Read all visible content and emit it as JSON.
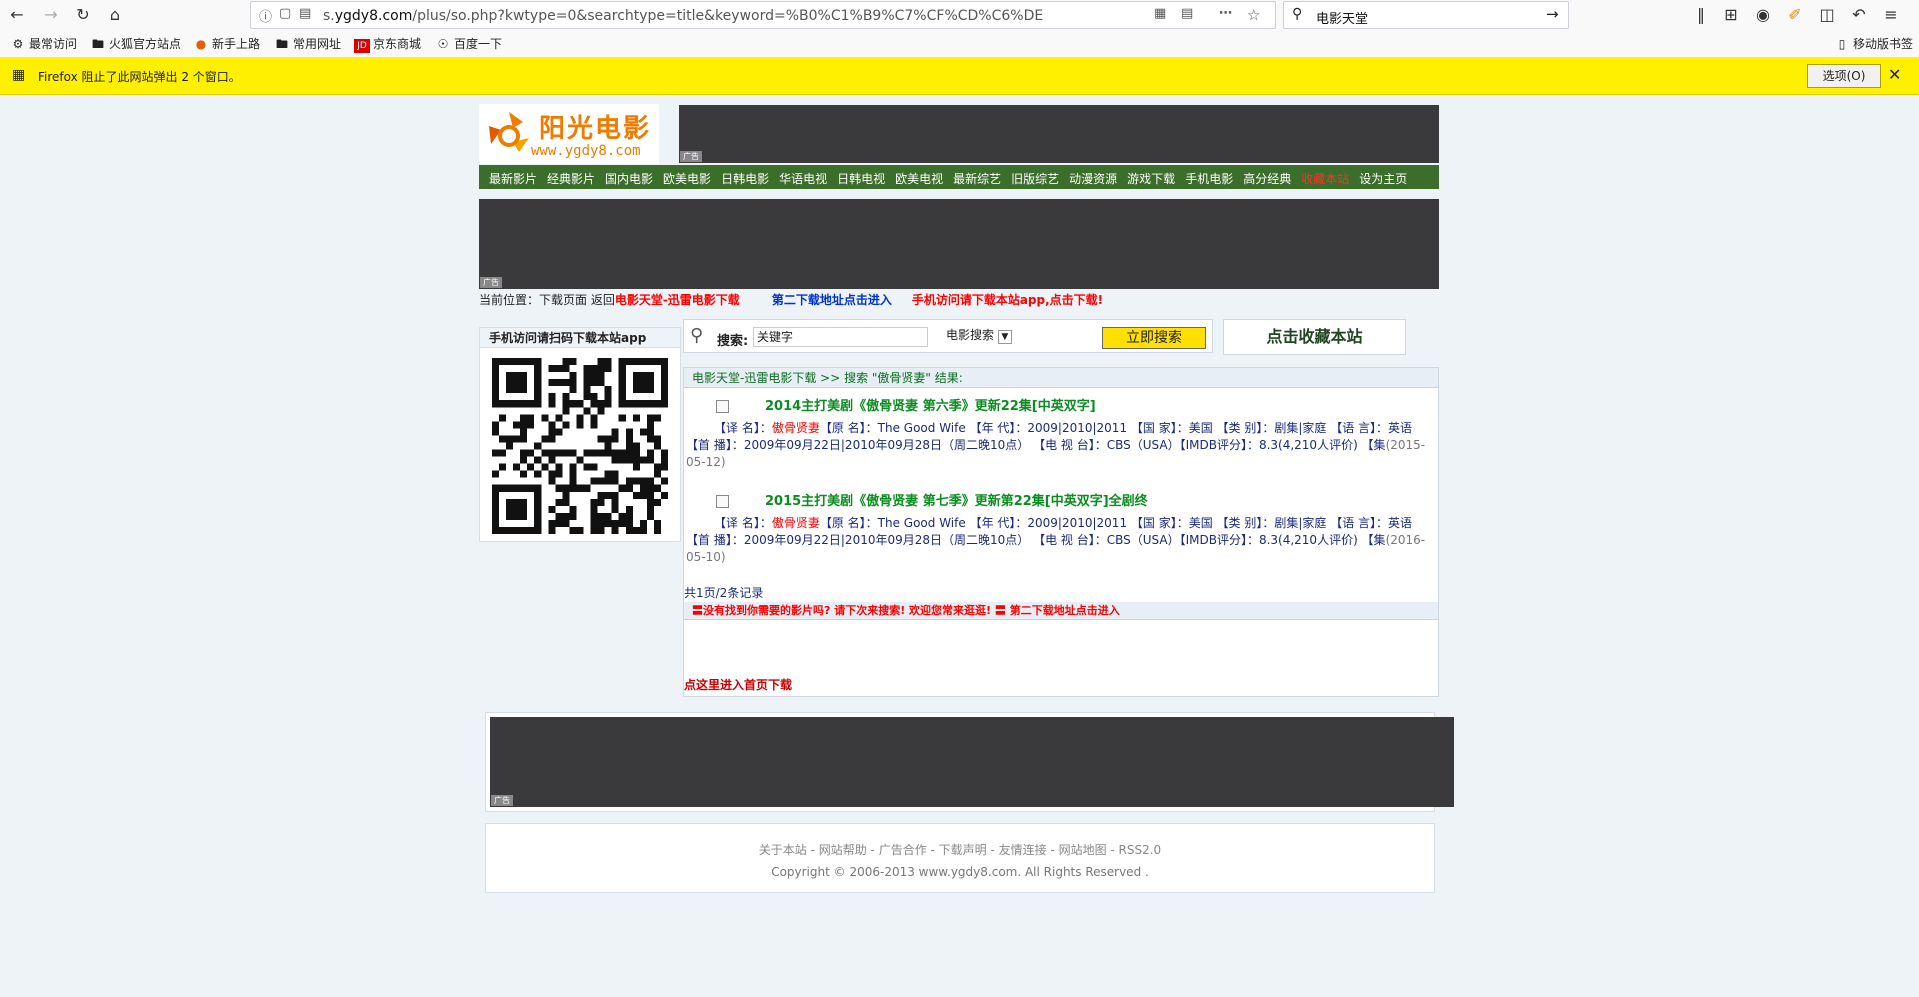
{
  "browser": {
    "url_prefix": "s.",
    "url_domain": "ygdy8.com",
    "url_rest": "/plus/so.php?kwtype=0&searchtype=title&keyword=%B0%C1%B9%C7%CF%CD%C6%DE",
    "search_value": "电影天堂",
    "bookmarks": [
      "最常访问",
      "火狐官方站点",
      "新手上路",
      "常用网址",
      "京东商城",
      "百度一下"
    ],
    "mobile_bookmarks": "移动版书签",
    "notification": "Firefox 阻止了此网站弹出 2 个窗口。",
    "notification_options": "选项(O)"
  },
  "site": {
    "logo_text": "阳光电影",
    "logo_url": "www.ygdy8.com",
    "ad_label": "广告",
    "nav": [
      "最新影片",
      "经典影片",
      "国内电影",
      "欧美电影",
      "日韩电影",
      "华语电视",
      "日韩电视",
      "欧美电视",
      "最新综艺",
      "旧版综艺",
      "动漫资源",
      "游戏下载",
      "手机电影",
      "高分经典",
      "收藏本站",
      "设为主页"
    ],
    "nav_red_index": 14,
    "crumb": {
      "prefix": "当前位置：下载页面 返回",
      "home": "电影天堂-迅雷电影下载",
      "second": "第二下载地址点击进入",
      "app": "手机访问请下载本站app,点击下载!"
    },
    "qr_title": "手机访问请扫码下载本站app",
    "search": {
      "label": "搜索:",
      "placeholder": "关键字",
      "select": "电影搜索",
      "button": "立即搜索"
    },
    "fav_button": "点击收藏本站",
    "results_head": "电影天堂-迅雷电影下载 >> 搜索 \"傲骨贤妻\" 结果:",
    "results": [
      {
        "title": "2014主打美剧《傲骨贤妻 第六季》更新22集[中英双字]",
        "line1_a": "【译 名】：",
        "line1_hl": "傲骨贤妻",
        "line1_b": "【原 名】：The Good Wife 【年 代】：2009|2010|2011 【国 家】：美国 【类 别】：剧集|家庭 【语 言】：英语 【首 播】：2009年09月22日|2010年09月28日（周二晚10点） 【电 视 台】：CBS（USA）【IMDB评分】：8.3(4,210人评价) 【集",
        "date": "(2015-05-12)"
      },
      {
        "title": "2015主打美剧《傲骨贤妻 第七季》更新第22集[中英双字]全剧终",
        "line1_a": "【译 名】：",
        "line1_hl": "傲骨贤妻",
        "line1_b": "【原 名】：The Good Wife 【年 代】：2009|2010|2011 【国 家】：美国 【类 别】：剧集|家庭 【语 言】：英语 【首 播】：2009年09月22日|2010年09月28日（周二晚10点） 【电 视 台】：CBS（USA）【IMDB评分】：8.3(4,210人评价) 【集",
        "date": "(2016-05-10)"
      }
    ],
    "page_count": "共1页/2条记录",
    "not_found": "〓没有找到你需要的影片吗? 请下次来搜索! 欢迎您常来逛逛! 〓 第二下载地址点击进入",
    "home_link": "点这里进入首页下载",
    "footer_links": "关于本站 - 网站帮助 - 广告合作 - 下载声明 - 友情连接 - 网站地图 - RSS2.0",
    "footer_copy": "Copyright © 2006-2013 www.ygdy8.com. All Rights Reserved ."
  }
}
